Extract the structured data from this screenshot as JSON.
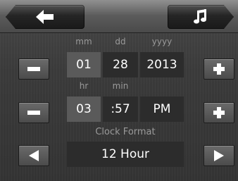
{
  "date_labels": {
    "month": "mm",
    "day": "dd",
    "year": "yyyy"
  },
  "date_values": {
    "month": "01",
    "day": "28",
    "year": "2013"
  },
  "time_labels": {
    "hour": "hr",
    "minute": "min"
  },
  "time_values": {
    "hour": "03",
    "minute": ":57",
    "ampm": "PM"
  },
  "clock_format": {
    "label": "Clock Format",
    "value": "12 Hour"
  },
  "icons": {
    "back": "arrow-left-icon",
    "music": "music-note-icon",
    "minus": "minus-icon",
    "plus": "plus-icon",
    "left": "triangle-left-icon",
    "right": "triangle-right-icon"
  }
}
